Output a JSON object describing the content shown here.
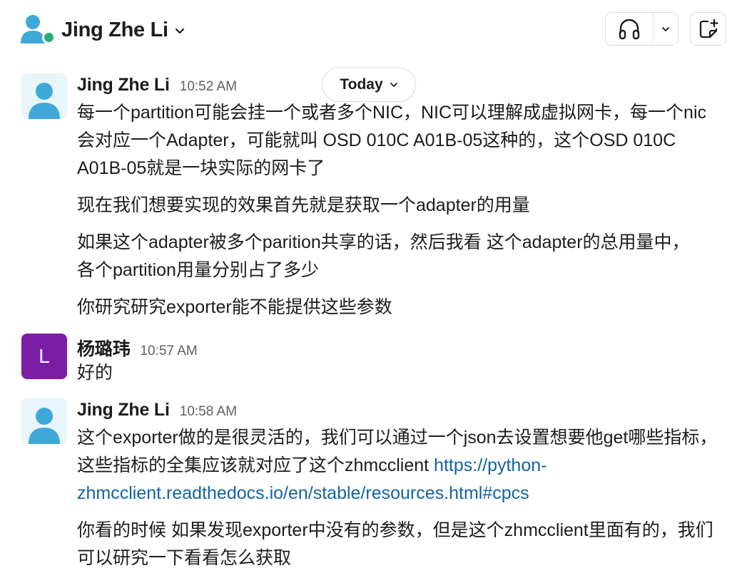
{
  "header": {
    "title": "Jing Zhe Li",
    "huddle_icon": "headphones-icon",
    "canvas_icon": "canvas-icon"
  },
  "colors": {
    "presence": "#2bac76",
    "letter_avatar": "#7c1da6",
    "link": "#1264a3"
  },
  "day_divider": {
    "label": "Today"
  },
  "messages": [
    {
      "sender": "Jing Zhe Li",
      "time": "10:52 AM",
      "paragraphs": [
        "每一个partition可能会挂一个或者多个NIC，NIC可以理解成虚拟网卡，每一个nic会对应一个Adapter，可能就叫 OSD 010C A01B-05这种的，这个OSD 010C A01B-05就是一块实际的网卡了",
        "现在我们想要实现的效果首先就是获取一个adapter的用量",
        "如果这个adapter被多个parition共享的话，然后我看 这个adapter的总用量中，各个partition用量分别占了多少",
        "你研究研究exporter能不能提供这些参数"
      ]
    },
    {
      "sender": "杨璐玮",
      "avatar_letter": "L",
      "time": "10:57 AM",
      "paragraphs": [
        "好的"
      ]
    },
    {
      "sender": "Jing Zhe Li",
      "time": "10:58 AM",
      "paragraph_1": "这个exporter做的是很灵活的，我们可以通过一个json去设置想要他get哪些指标，这些指标的全集应该就对应了这个zhmcclient ",
      "link": "https://python-zhmcclient.readthedocs.io/en/stable/resources.html#cpcs",
      "paragraph_2": "你看的时候 如果发现exporter中没有的参数，但是这个zhmcclient里面有的，我们可以研究一下看看怎么获取"
    }
  ]
}
